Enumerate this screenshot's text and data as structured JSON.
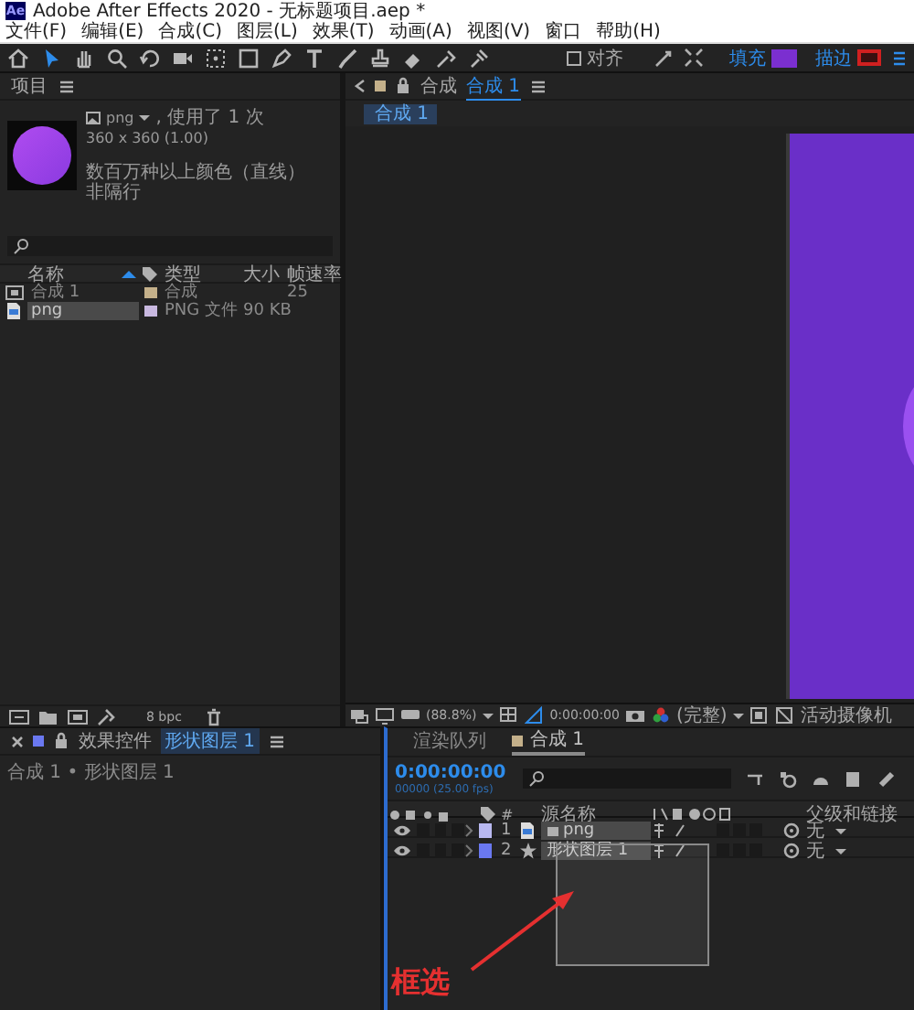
{
  "title_bar": {
    "logo": "Ae",
    "title": "Adobe After Effects 2020 - 无标题项目.aep *"
  },
  "menu": [
    "文件(F)",
    "编辑(E)",
    "合成(C)",
    "图层(L)",
    "效果(T)",
    "动画(A)",
    "视图(V)",
    "窗口",
    "帮助(H)"
  ],
  "toolbar": {
    "tools": [
      {
        "kind": "home",
        "selected": false
      },
      {
        "kind": "select",
        "selected": true
      },
      {
        "kind": "hand",
        "selected": false
      },
      {
        "kind": "zoom",
        "selected": false
      },
      {
        "kind": "rotate",
        "selected": false
      },
      {
        "kind": "camera",
        "selected": false
      },
      {
        "kind": "pan",
        "selected": false
      },
      {
        "kind": "rectangle",
        "selected": false
      },
      {
        "kind": "pen",
        "selected": false
      },
      {
        "kind": "type",
        "selected": false
      },
      {
        "kind": "brush",
        "selected": false
      },
      {
        "kind": "stamp",
        "selected": false
      },
      {
        "kind": "eraser",
        "selected": false
      },
      {
        "kind": "roto",
        "selected": false
      },
      {
        "kind": "puppet",
        "selected": false
      }
    ],
    "align": {
      "label": "对齐",
      "checked": false
    },
    "fill": {
      "label": "填充"
    },
    "stroke": {
      "label": "描边"
    }
  },
  "project": {
    "title": "项目",
    "preview": {
      "name": "png",
      "usage": ", 使用了 1 次",
      "dimensions": "360 x 360 (1.00)",
      "colors": "数百万种以上颜色（直线）",
      "interlace": "非隔行"
    },
    "columns": [
      "名称",
      "类型",
      "大小",
      "帧速率"
    ],
    "items": [
      {
        "kind": "comp",
        "name": "合成 1",
        "type": "合成",
        "fps": "25",
        "color": "#c4b08a",
        "selected": false
      },
      {
        "kind": "image",
        "name": "png",
        "type": "PNG 文件",
        "size": "90 KB",
        "color": "#c8b8e0",
        "selected": true
      }
    ],
    "bit_depth": "8 bpc"
  },
  "viewer": {
    "tab_prefix": "合成",
    "tab": "合成 1",
    "subtab": "合成 1",
    "zoom": "(88.8%)",
    "time": "0:00:00:00",
    "resolution": "(完整)",
    "camera": "活动摄像机"
  },
  "effects": {
    "tab_prefix": "效果控件",
    "layer": "形状图层 1",
    "breadcrumb": "合成 1 • 形状图层 1"
  },
  "timeline": {
    "tabs": [
      {
        "label": "渲染队列",
        "selected": false
      },
      {
        "label": "合成 1",
        "selected": true
      }
    ],
    "time": "0:00:00:00",
    "frame_info": "00000 (25.00 fps)",
    "columns": {
      "number": "#",
      "source": "源名称",
      "parent": "父级和链接"
    },
    "layers": [
      {
        "kind": "image",
        "number": "1",
        "name": "png",
        "color": "#b8b8f0",
        "parent": "无",
        "visible": true,
        "audio": false,
        "solo": false,
        "locked": false
      },
      {
        "kind": "shape",
        "number": "2",
        "name": "形状图层 1",
        "color": "#6a78f0",
        "parent": "无",
        "visible": true,
        "audio": false,
        "solo": false,
        "locked": false
      }
    ],
    "selection_marquee": true
  },
  "annotation": {
    "label": "框选"
  }
}
